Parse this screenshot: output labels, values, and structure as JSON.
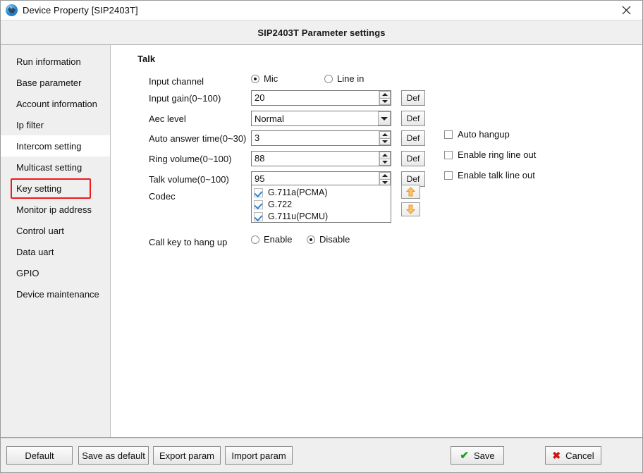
{
  "window": {
    "title": "Device Property [SIP2403T]",
    "icon": "globe-icon",
    "close_label": "✕"
  },
  "header": {
    "title": "SIP2403T Parameter settings"
  },
  "sidebar": {
    "selected": "Intercom setting",
    "items": [
      {
        "label": "Run information"
      },
      {
        "label": "Base parameter"
      },
      {
        "label": "Account information"
      },
      {
        "label": "Ip filter"
      },
      {
        "label": "Intercom setting"
      },
      {
        "label": "Multicast setting"
      },
      {
        "label": "Key setting"
      },
      {
        "label": "Monitor ip address"
      },
      {
        "label": "Control uart"
      },
      {
        "label": "Data uart"
      },
      {
        "label": "GPIO"
      },
      {
        "label": "Device maintenance"
      }
    ]
  },
  "annotation": {
    "color": "#ef1a1a",
    "target": "Intercom setting"
  },
  "main": {
    "group_label": "Talk",
    "input_channel": {
      "label": "Input channel",
      "options": [
        {
          "label": "Mic",
          "selected": true
        },
        {
          "label": "Line in",
          "selected": false
        }
      ]
    },
    "input_gain": {
      "label": "Input gain(0~100)",
      "value": "20",
      "def_label": "Def"
    },
    "aec_level": {
      "label": "Aec level",
      "value": "Normal",
      "def_label": "Def"
    },
    "auto_answer_time": {
      "label": "Auto answer time(0~30)",
      "value": "3",
      "def_label": "Def"
    },
    "ring_volume": {
      "label": "Ring volume(0~100)",
      "value": "88",
      "def_label": "Def"
    },
    "talk_volume": {
      "label": "Talk volume(0~100)",
      "value": "95",
      "def_label": "Def"
    },
    "codec": {
      "label": "Codec",
      "items": [
        {
          "label": "G.711a(PCMA)",
          "checked": true
        },
        {
          "label": "G.722",
          "checked": true
        },
        {
          "label": "G.711u(PCMU)",
          "checked": true
        }
      ],
      "move_up_icon": "arrow-up-icon",
      "move_down_icon": "arrow-down-icon",
      "arrow_color": "#f5a623"
    },
    "call_key_hang_up": {
      "label": "Call key to hang up",
      "options": [
        {
          "label": "Enable",
          "selected": false
        },
        {
          "label": "Disable",
          "selected": true
        }
      ]
    },
    "checkboxes": [
      {
        "label": "Auto hangup",
        "checked": false
      },
      {
        "label": "Enable ring line out",
        "checked": false
      },
      {
        "label": "Enable talk line out",
        "checked": false
      }
    ]
  },
  "footer": {
    "default_label": "Default",
    "save_as_default_label": "Save as default",
    "export_param_label": "Export param",
    "import_param_label": "Import param",
    "save_label": "Save",
    "cancel_label": "Cancel",
    "save_icon": "check-icon",
    "cancel_icon": "x-icon"
  }
}
